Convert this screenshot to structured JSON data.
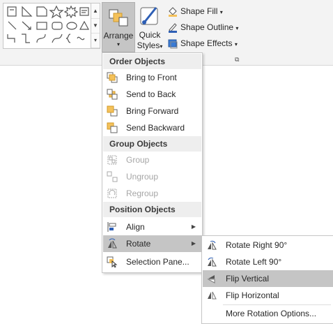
{
  "ribbon": {
    "arrange_label": "Arrange",
    "quick_styles_label1": "Quick",
    "quick_styles_label2": "Styles",
    "shape_fill": "Shape Fill",
    "shape_outline": "Shape Outline",
    "shape_effects": "Shape Effects",
    "dropdown_glyph": "▾",
    "launcher_glyph": "⧉",
    "shapes_gallery_icons": [
      "text-box",
      "line",
      "right-triangle",
      "snip-rectangle",
      "star-5",
      "star-8",
      "text-box-alt",
      "line-diagonal",
      "line-arrow",
      "rectangle",
      "rounded-rectangle",
      "oval",
      "triangle",
      "elbow-connector",
      "elbow-arrow",
      "curved-connector",
      "curve",
      "brace",
      "wave",
      "more"
    ],
    "accent_color": "#f4c15a",
    "outline_color": "#2e5fb5",
    "effects_color": "#3a7bd5"
  },
  "arrange_menu": {
    "headers": [
      "Order Objects",
      "Group Objects",
      "Position Objects"
    ],
    "items": [
      {
        "label": "Bring to Front",
        "icon": "bring-to-front-icon",
        "enabled": true
      },
      {
        "label": "Send to Back",
        "icon": "send-to-back-icon",
        "enabled": true
      },
      {
        "label": "Bring Forward",
        "icon": "bring-forward-icon",
        "enabled": true
      },
      {
        "label": "Send Backward",
        "icon": "send-backward-icon",
        "enabled": true
      },
      {
        "label": "Group",
        "icon": "group-icon",
        "enabled": false
      },
      {
        "label": "Ungroup",
        "icon": "ungroup-icon",
        "enabled": false
      },
      {
        "label": "Regroup",
        "icon": "regroup-icon",
        "enabled": false
      },
      {
        "label": "Align",
        "icon": "align-icon",
        "enabled": true,
        "has_submenu": true
      },
      {
        "label": "Rotate",
        "icon": "rotate-icon",
        "enabled": true,
        "has_submenu": true,
        "active": true
      },
      {
        "label": "Selection Pane...",
        "icon": "selection-pane-icon",
        "enabled": true
      }
    ]
  },
  "rotate_submenu": {
    "items": [
      {
        "label": "Rotate Right 90°",
        "icon": "rotate-right-icon"
      },
      {
        "label": "Rotate Left 90°",
        "icon": "rotate-left-icon"
      },
      {
        "label": "Flip Vertical",
        "icon": "flip-vertical-icon",
        "active": true
      },
      {
        "label": "Flip Horizontal",
        "icon": "flip-horizontal-icon"
      },
      {
        "label": "More Rotation Options...",
        "icon": ""
      }
    ]
  },
  "submenu_arrow": "▶"
}
